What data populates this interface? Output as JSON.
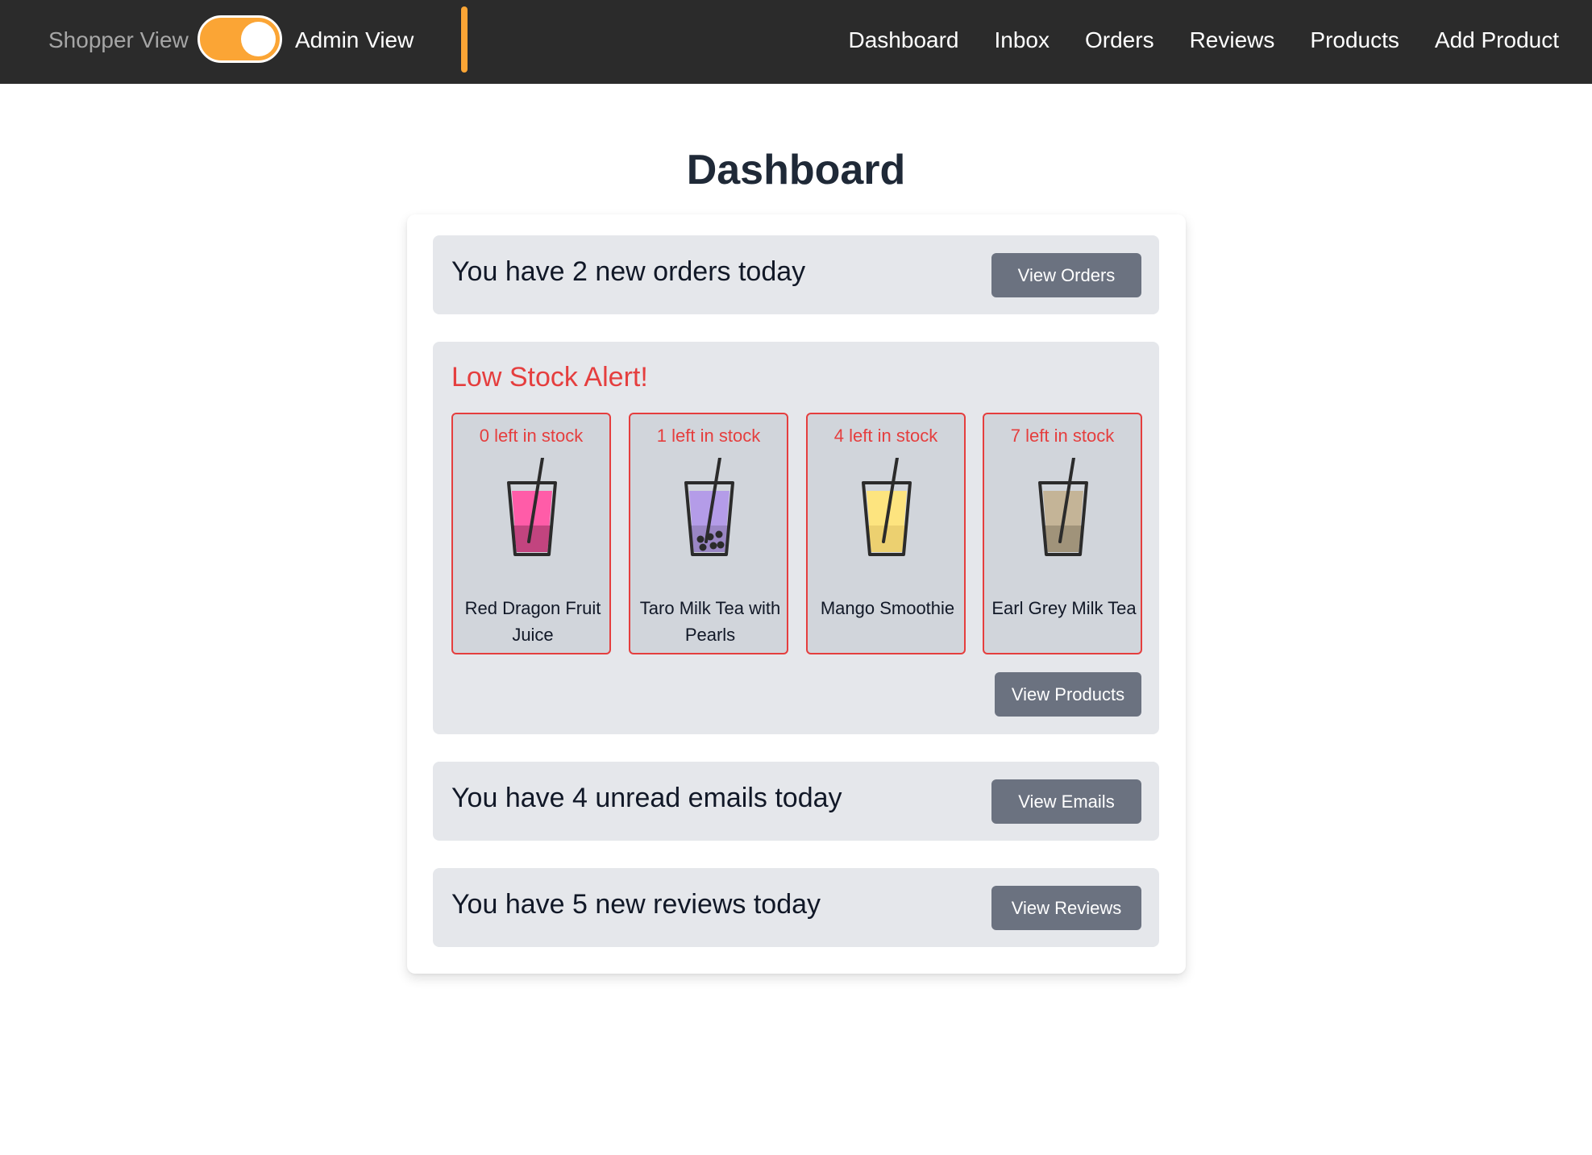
{
  "navbar": {
    "shopper_view": "Shopper View",
    "admin_view": "Admin View",
    "links": [
      "Dashboard",
      "Inbox",
      "Orders",
      "Reviews",
      "Products",
      "Add Product"
    ]
  },
  "page": {
    "title": "Dashboard"
  },
  "orders": {
    "text": "You have 2 new orders today",
    "button": "View Orders"
  },
  "low_stock": {
    "title": "Low Stock Alert!",
    "button": "View Products",
    "products": [
      {
        "stock": "0 left in stock",
        "name": "Red Dragon Fruit Juice",
        "icon": "red-dragon-fruit-drink-icon",
        "liquid_color": "#ff5ca8",
        "bottom_color": "#c2447f"
      },
      {
        "stock": "1 left in stock",
        "name": "Taro Milk Tea with Pearls",
        "icon": "taro-milk-tea-icon",
        "liquid_color": "#b49ce8",
        "bottom_color": "#9a86c4"
      },
      {
        "stock": "4 left in stock",
        "name": "Mango Smoothie",
        "icon": "mango-smoothie-icon",
        "liquid_color": "#fde47f",
        "bottom_color": "#ecd070"
      },
      {
        "stock": "7 left in stock",
        "name": "Earl Grey Milk Tea",
        "icon": "earl-grey-milk-tea-icon",
        "liquid_color": "#c4b497",
        "bottom_color": "#a0937a"
      }
    ]
  },
  "emails": {
    "text": "You have 4 unread emails today",
    "button": "View Emails"
  },
  "reviews": {
    "text": "You have 5 new reviews today",
    "button": "View Reviews"
  },
  "colors": {
    "navbar_bg": "#2b2b2b",
    "accent": "#fba535",
    "alert": "#e53e3e",
    "button": "#6b7280",
    "panel": "#e5e7eb",
    "product_card": "#d1d5db"
  }
}
